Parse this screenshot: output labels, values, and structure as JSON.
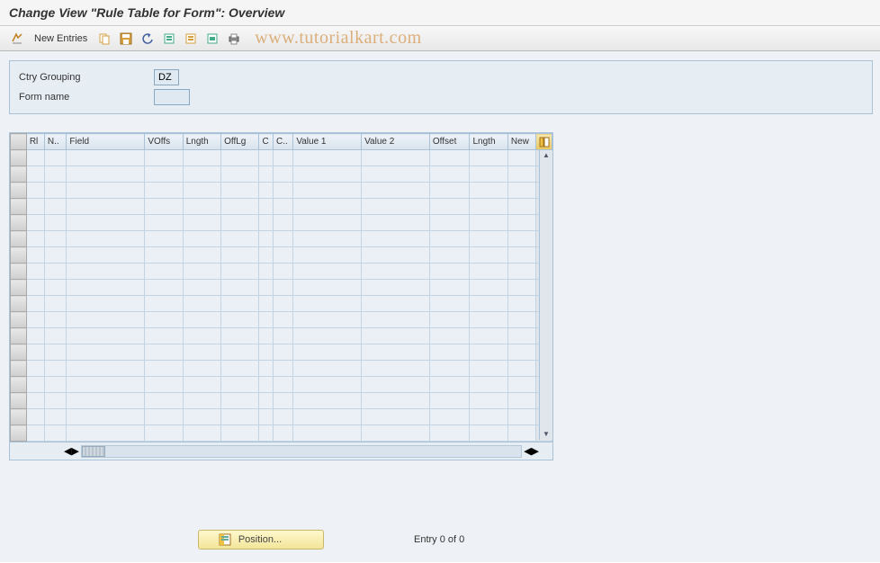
{
  "title": "Change View \"Rule Table for Form\": Overview",
  "toolbar": {
    "new_entries": "New Entries"
  },
  "watermark": "www.tutorialkart.com",
  "form": {
    "ctry_label": "Ctry Grouping",
    "ctry_value": "DZ",
    "form_label": "Form name",
    "form_value": ""
  },
  "table": {
    "columns": [
      "Rl",
      "N..",
      "Field",
      "VOffs",
      "Lngth",
      "OffLg",
      "C",
      "C..",
      "Value 1",
      "Value 2",
      "Offset",
      "Lngth",
      "New"
    ],
    "rows": 18
  },
  "footer": {
    "position_label": "Position...",
    "entry_status": "Entry 0 of 0"
  }
}
